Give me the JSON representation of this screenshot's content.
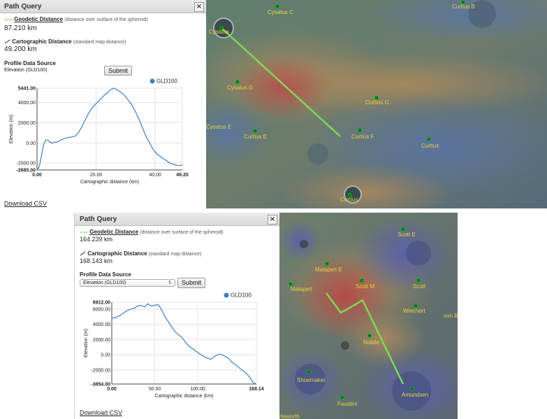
{
  "panel1": {
    "title": "Path Query",
    "close": "×",
    "geodetic_title": "Geodetic Distance",
    "geodetic_sub": "(distance over surface of the spheroid)",
    "geodetic_value": "87.210 km",
    "carto_title": "Cartographic Distance",
    "carto_sub": "(standard map distance)",
    "carto_value": "49.200 km",
    "source_title": "Profile Data Source",
    "source_value": "Elevation (GLD100)",
    "submit": "Submit",
    "download": "Download CSV"
  },
  "panel2": {
    "title": "Path Query",
    "close": "×",
    "geodetic_title": "Geodetic Distance",
    "geodetic_sub": "(distance over surface of the spheroid)",
    "geodetic_value": "164.239 km",
    "carto_title": "Cartographic Distance",
    "carto_sub": "(standard map distance)",
    "carto_value": "168.143 km",
    "source_title": "Profile Data Source",
    "source_value": "Elevation (GLD100)",
    "submit": "Submit",
    "download": "Download CSV"
  },
  "map1": {
    "labels": [
      "Cysatus C",
      "Curtius B",
      "Cysatus",
      "Cysatus G",
      "Curtius G",
      "Curtius E",
      "Cysatus E",
      "Curtius F",
      "Curtius",
      "Curtius"
    ],
    "path_color": "#7ed957"
  },
  "map2": {
    "labels": [
      "Scott E",
      "Malapert E",
      "Malapert",
      "Scott M",
      "Scott",
      "Wiechert",
      "von B",
      "Nobile",
      "Shoemaker",
      "Amundsen",
      "Faustini",
      "Haworth"
    ],
    "path_color": "#7ed957"
  },
  "chart_data": [
    {
      "type": "line",
      "title": "",
      "xlabel": "Cartographic distance (km)",
      "ylabel": "Elevation (m)",
      "xlim": [
        0,
        49.2
      ],
      "ylim": [
        -2685,
        5441
      ],
      "x_ticks": [
        "0.00",
        "20.00",
        "40.00",
        "49.20"
      ],
      "y_ticks": [
        "5441.00",
        "4000.00",
        "2000.00",
        "0.00",
        "-2000.00",
        "-2685.00"
      ],
      "legend": "GLD100",
      "legend_position": "top-right",
      "grid": true,
      "series": [
        {
          "name": "GLD100",
          "color": "#3c7fc4",
          "x": [
            0,
            0.8,
            1.5,
            2.2,
            3,
            3.8,
            4.5,
            5.3,
            6,
            7,
            8,
            9,
            10,
            11,
            12,
            13,
            14,
            15,
            16,
            17,
            18,
            19,
            20,
            21,
            22,
            23,
            24,
            25,
            26,
            27,
            28,
            29,
            30,
            31,
            32,
            33,
            34,
            35,
            36,
            37,
            38,
            39,
            40,
            41,
            42,
            43,
            44,
            45,
            46,
            47,
            48,
            49.2
          ],
          "y": [
            -2685,
            -2300,
            -1300,
            -200,
            300,
            250,
            50,
            -20,
            80,
            100,
            300,
            400,
            500,
            550,
            600,
            700,
            1000,
            1500,
            2100,
            2700,
            3200,
            3600,
            3900,
            4200,
            4500,
            4800,
            5000,
            5300,
            5441,
            5300,
            5100,
            4900,
            4600,
            4200,
            3800,
            3300,
            2700,
            2000,
            1300,
            600,
            100,
            -500,
            -900,
            -1200,
            -1400,
            -1600,
            -1800,
            -2000,
            -2100,
            -2200,
            -2250,
            -2200
          ]
        }
      ]
    },
    {
      "type": "line",
      "title": "",
      "xlabel": "Cartographic distance (km)",
      "ylabel": "Elevation (m)",
      "xlim": [
        0,
        168.14
      ],
      "ylim": [
        -3854,
        6912
      ],
      "x_ticks": [
        "0.00",
        "50.00",
        "100.00",
        "168.14"
      ],
      "y_ticks": [
        "6912.00",
        "6000.00",
        "4000.00",
        "2000.00",
        "0.00",
        "-2000.00",
        "-3854.00"
      ],
      "legend": "GLD100",
      "legend_position": "top-right",
      "grid": true,
      "series": [
        {
          "name": "GLD100",
          "color": "#3c7fc4",
          "x": [
            0,
            5,
            10,
            15,
            18,
            22,
            26,
            30,
            34,
            38,
            42,
            46,
            50,
            54,
            58,
            62,
            66,
            70,
            74,
            78,
            82,
            86,
            90,
            95,
            100,
            105,
            110,
            115,
            120,
            125,
            130,
            135,
            140,
            145,
            150,
            155,
            160,
            164,
            168.14
          ],
          "y": [
            4800,
            4900,
            5200,
            5600,
            5800,
            6000,
            6100,
            6400,
            6500,
            6300,
            6700,
            6400,
            6500,
            6600,
            5900,
            5000,
            4300,
            3600,
            3000,
            2600,
            2200,
            1600,
            1100,
            700,
            300,
            -100,
            -400,
            -600,
            -200,
            100,
            -100,
            -400,
            -1000,
            -1400,
            -1900,
            -2300,
            -2900,
            -3600,
            -3900
          ]
        }
      ]
    }
  ]
}
